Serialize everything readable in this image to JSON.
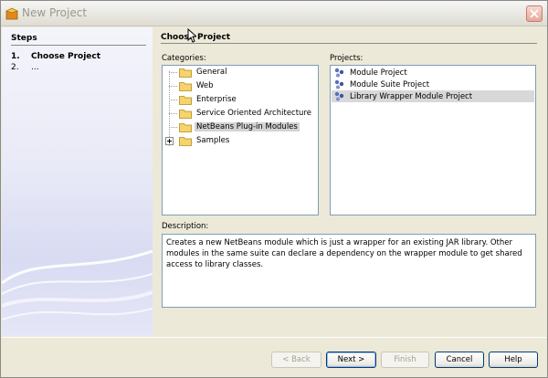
{
  "window": {
    "title": "New Project"
  },
  "steps": {
    "heading": "Steps",
    "items": [
      {
        "num": "1.",
        "label": "Choose Project",
        "active": true
      },
      {
        "num": "2.",
        "label": "...",
        "active": false
      }
    ]
  },
  "main": {
    "heading": "Choose Project",
    "categories_label": "Categories:",
    "projects_label": "Projects:",
    "description_label": "Description:",
    "categories": [
      {
        "label": "General"
      },
      {
        "label": "Web"
      },
      {
        "label": "Enterprise"
      },
      {
        "label": "Service Oriented Architecture"
      },
      {
        "label": "NetBeans Plug-in Modules",
        "selected": true
      },
      {
        "label": "Samples",
        "expandable": true
      }
    ],
    "projects": [
      {
        "label": "Module Project"
      },
      {
        "label": "Module Suite Project"
      },
      {
        "label": "Library Wrapper Module Project",
        "selected": true
      }
    ],
    "description": "Creates a new NetBeans module which is just a wrapper for an existing JAR library. Other modules in the same suite can declare a dependency on the wrapper module to get shared access to library classes."
  },
  "buttons": {
    "back": "< Back",
    "next": "Next >",
    "finish": "Finish",
    "cancel": "Cancel",
    "help": "Help"
  },
  "colors": {
    "selection": "#d3d3d3",
    "steps_panel": "#e9eaf7",
    "accent": "#003c74"
  }
}
